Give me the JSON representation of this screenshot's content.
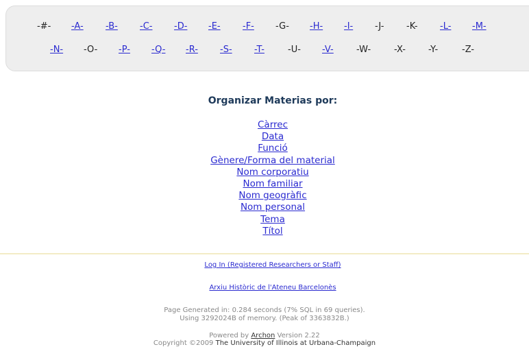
{
  "alphabet": {
    "row1": [
      {
        "label": "-#-",
        "link": false
      },
      {
        "label": "-A-",
        "link": true
      },
      {
        "label": "-B-",
        "link": true
      },
      {
        "label": "-C-",
        "link": true
      },
      {
        "label": "-D-",
        "link": true
      },
      {
        "label": "-E-",
        "link": true
      },
      {
        "label": "-F-",
        "link": true
      },
      {
        "label": "-G-",
        "link": false
      },
      {
        "label": "-H-",
        "link": true
      },
      {
        "label": "-I-",
        "link": true
      },
      {
        "label": "-J-",
        "link": false
      },
      {
        "label": "-K-",
        "link": false
      },
      {
        "label": "-L-",
        "link": true
      },
      {
        "label": "-M-",
        "link": true
      }
    ],
    "row2": [
      {
        "label": "-N-",
        "link": true
      },
      {
        "label": "-O-",
        "link": false
      },
      {
        "label": "-P-",
        "link": true
      },
      {
        "label": "-Q-",
        "link": true
      },
      {
        "label": "-R-",
        "link": true
      },
      {
        "label": "-S-",
        "link": true
      },
      {
        "label": "-T-",
        "link": true
      },
      {
        "label": "-U-",
        "link": false
      },
      {
        "label": "-V-",
        "link": true
      },
      {
        "label": "-W-",
        "link": false
      },
      {
        "label": "-X-",
        "link": false
      },
      {
        "label": "-Y-",
        "link": false
      },
      {
        "label": "-Z-",
        "link": false
      }
    ]
  },
  "organize": {
    "heading": "Organizar Materias por:",
    "items": [
      "Càrrec",
      "Data",
      "Funció",
      "Gènere/Forma del material",
      "Nom corporatiu",
      "Nom familiar",
      "Nom geogràfic",
      "Nom personal",
      "Tema",
      "Títol"
    ]
  },
  "footer": {
    "login_link": "Log In (Registered Researchers or Staff)",
    "archive_link": "Arxiu Històric de l'Ateneu Barcelonès",
    "generated_line1": "Page Generated in: 0.284 seconds (7% SQL in 69 queries).",
    "generated_line2": "Using 3292024B of memory. (Peak of 3363832B.)",
    "powered_prefix": "Powered by ",
    "powered_link": "Archon",
    "powered_suffix": " Version 2.22",
    "copyright_prefix": "Copyright ©2009 ",
    "copyright_org": "The University of Illinois at Urbana-Champaign"
  }
}
